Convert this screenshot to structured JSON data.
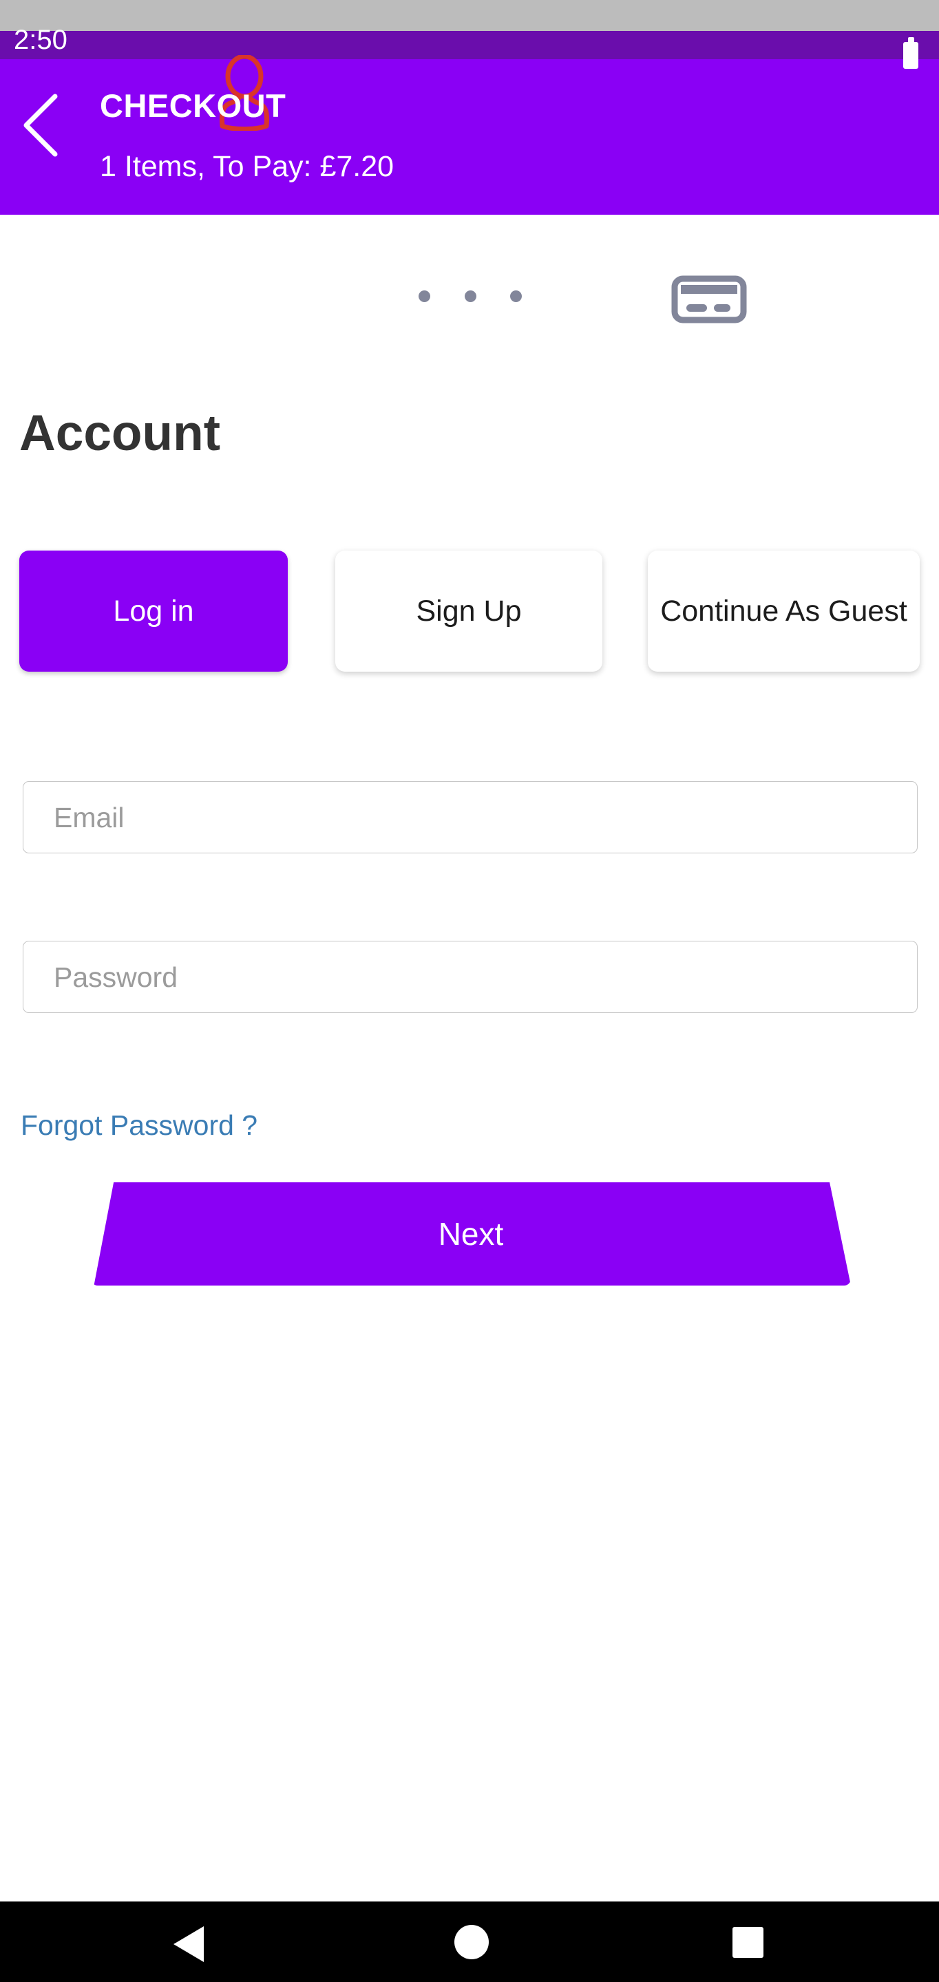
{
  "status_bar": {
    "time": "2:50",
    "battery_icon": "battery-icon"
  },
  "header": {
    "back_icon": "chevron-left-icon",
    "title": "CHECKOUT",
    "subtitle": "1 Items, To Pay: £7.20",
    "bg_color": "#8a00f5",
    "bg_color_dark": "#6a0dac"
  },
  "steps": {
    "account_icon": "person-icon",
    "account_icon_color": "#d9342b",
    "separator_icon": "three-dots-icon",
    "payment_icon": "credit-card-icon",
    "payment_icon_color": "#82869a"
  },
  "main": {
    "page_title": "Account",
    "tabs": [
      {
        "label": "Log in",
        "active": true
      },
      {
        "label": "Sign Up",
        "active": false
      },
      {
        "label": "Continue As Guest",
        "active": false
      }
    ],
    "fields": [
      {
        "name": "email",
        "placeholder": "Email",
        "value": ""
      },
      {
        "name": "password",
        "placeholder": "Password",
        "value": ""
      }
    ],
    "forgot_password_label": "Forgot Password ?",
    "forgot_password_color": "#3a7cb4",
    "next_button_label": "Next",
    "accent_color": "#8a00f5"
  },
  "nav_bar": {
    "back_icon": "triangle-back-icon",
    "home_icon": "circle-home-icon",
    "recents_icon": "square-recents-icon"
  }
}
